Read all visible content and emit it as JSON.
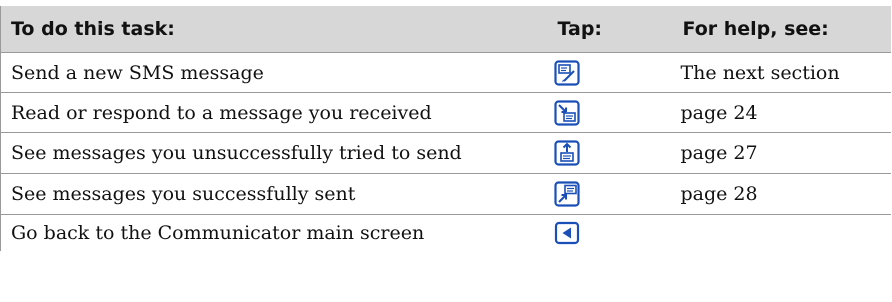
{
  "header": {
    "task": "To do this task:",
    "tap": "Tap:",
    "help": "For help, see:"
  },
  "rows": [
    {
      "task": "Send a new SMS message",
      "icon": "new-message-icon",
      "help": "The next section"
    },
    {
      "task": "Read or respond to a message you received",
      "icon": "inbox-icon",
      "help": "page 24"
    },
    {
      "task": "See messages you unsuccessfully tried to send",
      "icon": "outbox-icon",
      "help": "page 27"
    },
    {
      "task": "See messages you successfully sent",
      "icon": "sent-items-icon",
      "help": "page 28"
    },
    {
      "task": "Go back to the Communicator main screen",
      "icon": "back-arrow-icon",
      "help": ""
    }
  ],
  "colors": {
    "header_bg": "#d7d7d7",
    "icon_blue": "#1a4fb8",
    "rule": "#9a9a9a"
  }
}
